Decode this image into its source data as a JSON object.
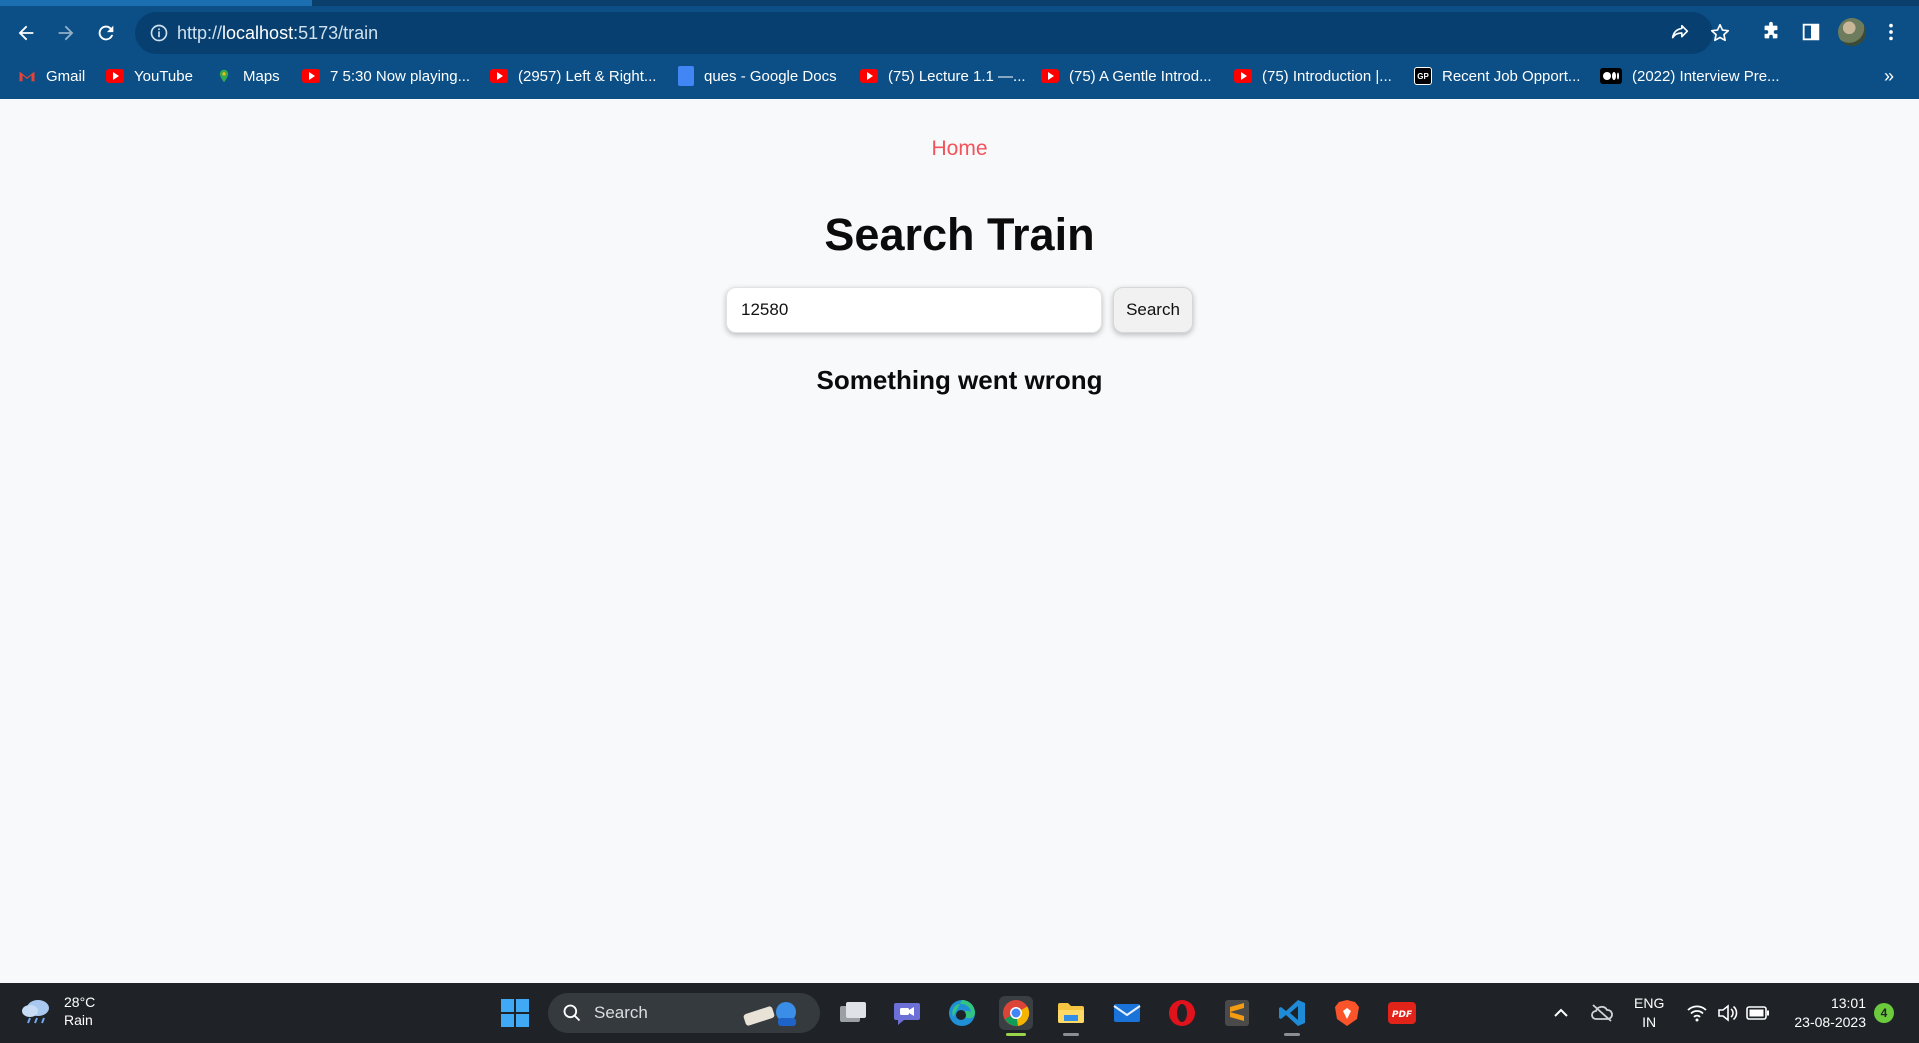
{
  "browser": {
    "url_scheme_prefix": "http://",
    "url_host": "localhost",
    "url_path": ":5173/train",
    "bookmarks": [
      {
        "label": "Gmail",
        "icon": "gmail-icon"
      },
      {
        "label": "YouTube",
        "icon": "youtube-icon"
      },
      {
        "label": "Maps",
        "icon": "maps-icon"
      },
      {
        "label": "7 5:30 Now playing...",
        "icon": "youtube-icon"
      },
      {
        "label": "(2957) Left & Right...",
        "icon": "youtube-icon"
      },
      {
        "label": "ques - Google Docs",
        "icon": "google-docs-icon"
      },
      {
        "label": "(75) Lecture 1.1 —...",
        "icon": "youtube-icon"
      },
      {
        "label": "(75) A Gentle Introd...",
        "icon": "youtube-icon"
      },
      {
        "label": "(75) Introduction |...",
        "icon": "youtube-icon"
      },
      {
        "label": "Recent Job Opport...",
        "icon": "gp-icon"
      },
      {
        "label": "(2022) Interview Pre...",
        "icon": "medium-icon"
      }
    ],
    "bookmarks_overflow": "»",
    "colors": {
      "chrome": "#0b4f86",
      "omnibox": "#074070"
    }
  },
  "page": {
    "nav_home": "Home",
    "title": "Search Train",
    "search_value": "12580",
    "search_button": "Search",
    "error_message": "Something went wrong",
    "colors": {
      "home_link": "#f2545b",
      "background": "#f8f9fb"
    }
  },
  "taskbar": {
    "weather_temp": "28°C",
    "weather_desc": "Rain",
    "search_label": "Search",
    "lang_line1": "ENG",
    "lang_line2": "IN",
    "time": "13:01",
    "date": "23-08-2023",
    "notification_count": "4"
  }
}
